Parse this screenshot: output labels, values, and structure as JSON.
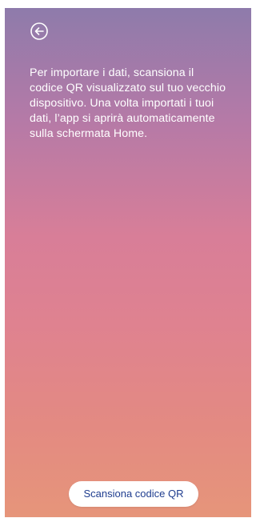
{
  "header": {
    "back_icon": "arrow-left-circle-icon"
  },
  "main": {
    "instructions": "Per importare i dati, scansiona il codice QR visualizzato sul tuo vecchio dispositivo. Una volta importati i tuoi dati, l’app si aprirà automaticamente sulla schermata Home."
  },
  "footer": {
    "scan_button_label": "Scansiona codice QR"
  },
  "colors": {
    "gradient_top": "#8e7bab",
    "gradient_middle": "#d87e98",
    "gradient_bottom": "#e6957a",
    "button_text": "#1f3d8f"
  }
}
